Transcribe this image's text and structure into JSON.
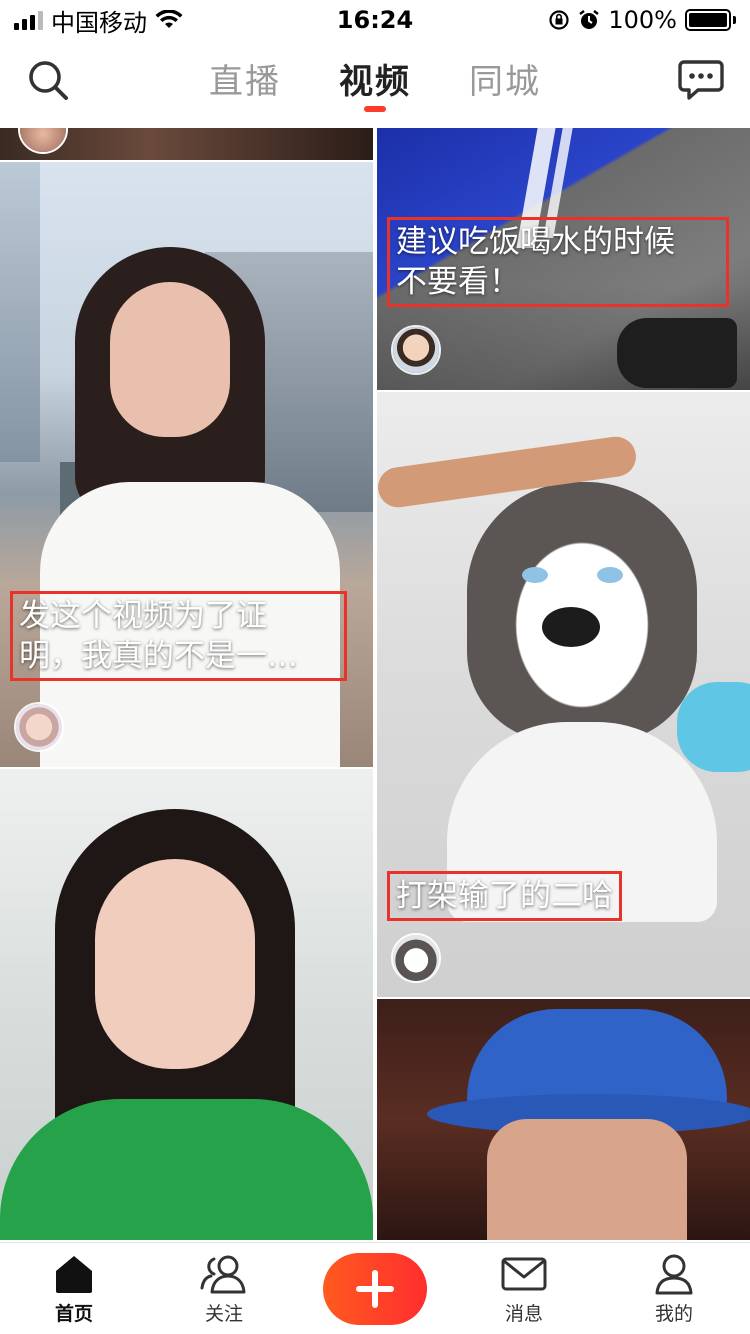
{
  "status_bar": {
    "carrier": "中国移动",
    "time": "16:24",
    "battery_percent": "100%",
    "battery_level": 1.0
  },
  "top_nav": {
    "tabs": [
      {
        "label": "直播",
        "active": false
      },
      {
        "label": "视频",
        "active": true
      },
      {
        "label": "同城",
        "active": false
      }
    ],
    "left_icon": "search-icon",
    "right_icon": "message-bubble-icon"
  },
  "feed": {
    "cards": [
      {
        "caption": "",
        "avatar": "avatar-woman"
      },
      {
        "caption": "建议吃饭喝水的时候\n不要看！",
        "avatar": "avatar-man-glasses"
      },
      {
        "caption": "发这个视频为了证\n明，我真的不是一…",
        "avatar": "avatar-girl"
      },
      {
        "caption": "打架输了的二哈",
        "avatar": "avatar-husky"
      },
      {
        "caption": "",
        "avatar": ""
      },
      {
        "caption": "",
        "avatar": ""
      }
    ]
  },
  "bottom_bar": {
    "items": [
      {
        "label": "首页",
        "icon": "home-icon",
        "active": true
      },
      {
        "label": "关注",
        "icon": "people-icon",
        "active": false
      },
      {
        "label": "",
        "icon": "plus-icon",
        "active": false
      },
      {
        "label": "消息",
        "icon": "envelope-icon",
        "active": false
      },
      {
        "label": "我的",
        "icon": "person-icon",
        "active": false
      }
    ]
  },
  "colors": {
    "accent": "#fe3b2a",
    "caption_border": "#e8322a",
    "add_button_start": "#ff5a1f",
    "add_button_end": "#ff2e2e"
  }
}
